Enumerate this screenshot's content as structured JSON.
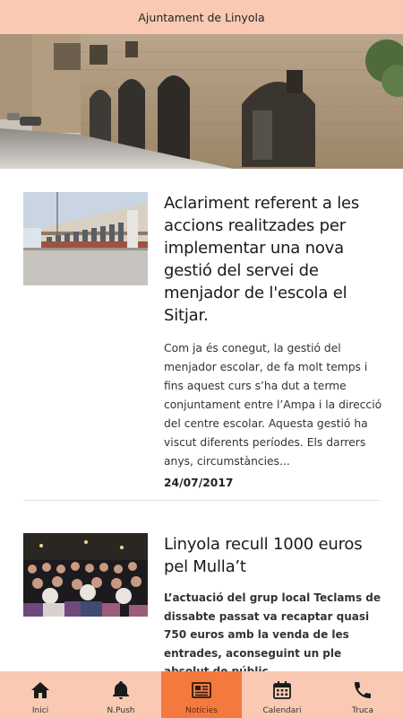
{
  "header": {
    "title": "Ajuntament de Linyola"
  },
  "articles": [
    {
      "title": "Aclariment referent a les accions realitzades per implementar una nova gestió del servei de menjador de l'escola el Sitjar.",
      "excerpt": "Com ja és conegut, la gestió del menjador escolar, de fa molt temps i fins aquest curs s’ha dut a terme conjuntament entre l’Ampa i la direcció del centre escolar. Aquesta gestió ha viscut diferents períodes. Els darrers anys, circumstàncies...",
      "date": "24/07/2017"
    },
    {
      "title": "Linyola recull 1000 euros pel Mulla’t",
      "excerpt": "L’actuació del grup local Teclams de dissabte passat va recaptar quasi 750 euros amb la venda de les entrades, aconseguint un ple absolut de públic"
    }
  ],
  "tabs": [
    {
      "label": "Inici",
      "icon": "home-icon",
      "active": false
    },
    {
      "label": "N.Push",
      "icon": "bell-icon",
      "active": false
    },
    {
      "label": "Notícies",
      "icon": "newspaper-icon",
      "active": true
    },
    {
      "label": "Calendari",
      "icon": "calendar-icon",
      "active": false
    },
    {
      "label": "Truca",
      "icon": "phone-icon",
      "active": false
    }
  ],
  "colors": {
    "header_bg": "#f9c9b3",
    "tab_active_bg": "#f4793f"
  }
}
